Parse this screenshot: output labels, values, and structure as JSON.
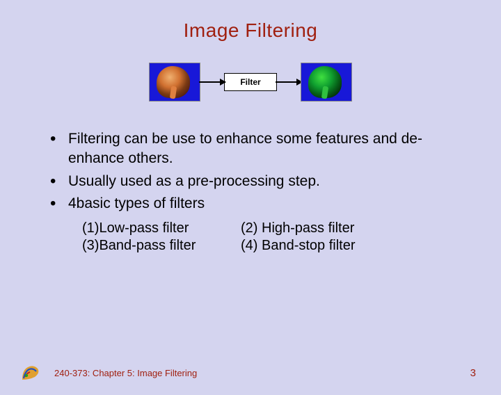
{
  "title": "Image Filtering",
  "diagram": {
    "filter_box_label": "Filter"
  },
  "bullets": {
    "b1": "Filtering can be use to enhance some features and de-enhance others.",
    "b2": "Usually used as a pre-processing step.",
    "b3": " 4basic types of filters"
  },
  "filter_types": {
    "f1": "(1)Low-pass filter",
    "f2": "(2) High-pass filter",
    "f3": "(3)Band-pass filter",
    "f4": "(4) Band-stop filter"
  },
  "footer": {
    "chapter": "240-373: Chapter 5: Image Filtering",
    "page": "3"
  }
}
